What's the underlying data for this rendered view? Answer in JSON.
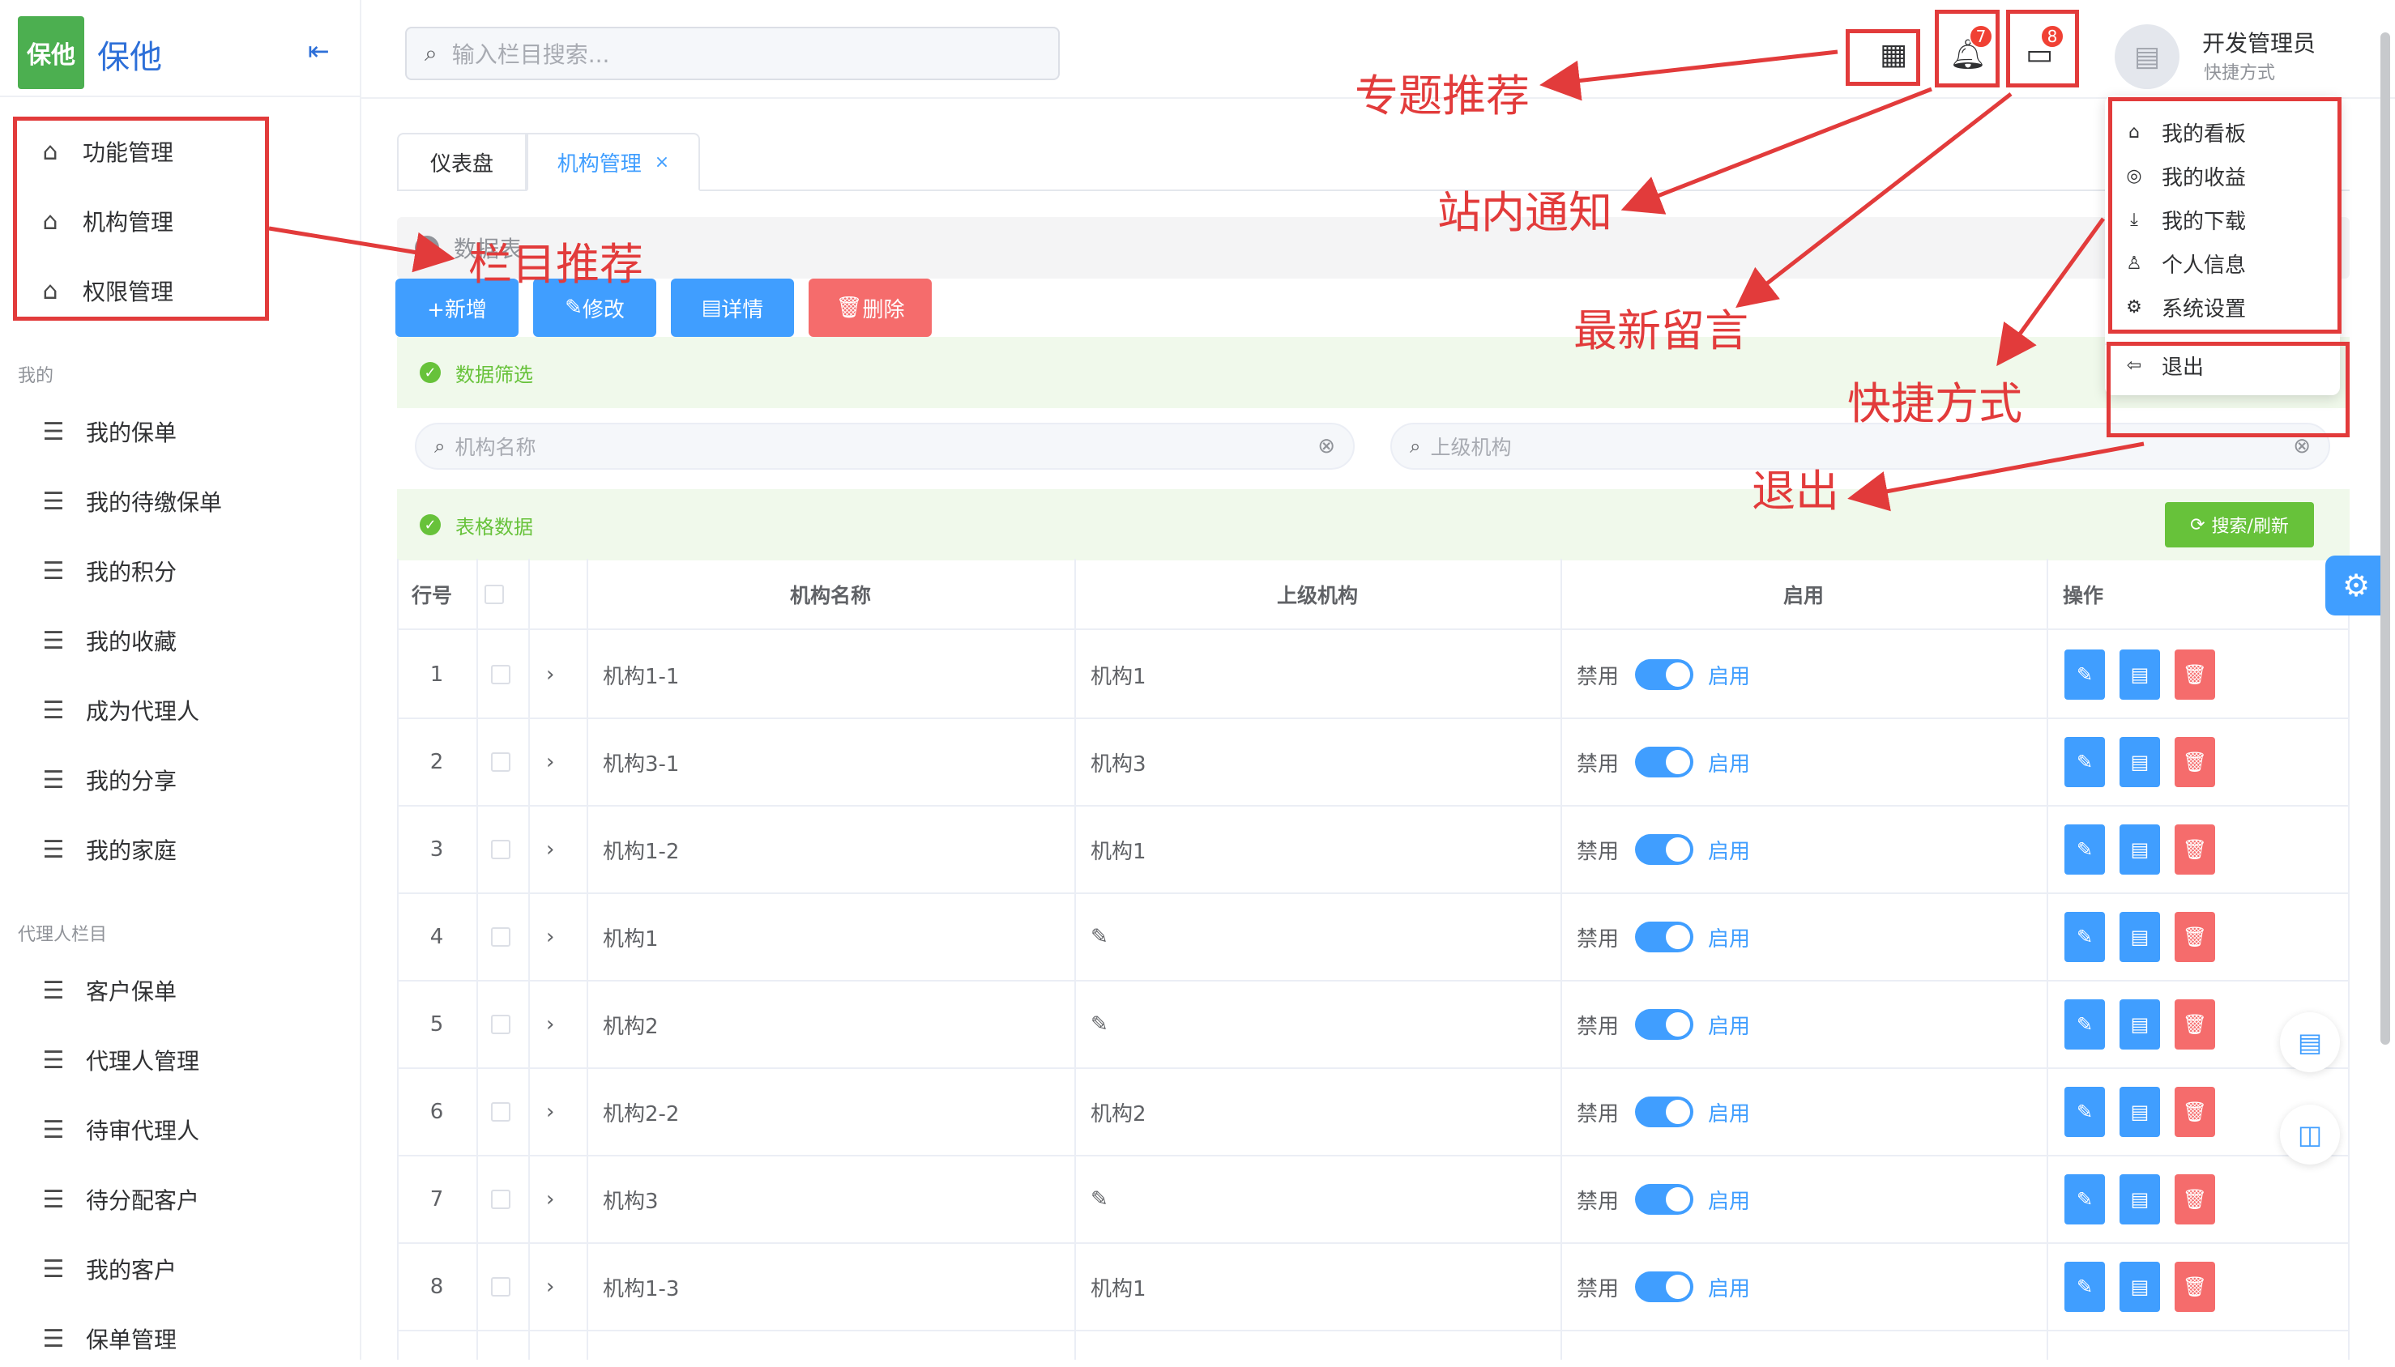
{
  "sidebar": {
    "brand": "保他",
    "logo_text": "保他",
    "top_items": [
      {
        "label": "功能管理",
        "icon": "home-icon"
      },
      {
        "label": "机构管理",
        "icon": "home-icon"
      },
      {
        "label": "权限管理",
        "icon": "home-icon"
      }
    ],
    "groups": [
      {
        "title": "我的",
        "items": [
          "我的保单",
          "我的待缴保单",
          "我的积分",
          "我的收藏",
          "成为代理人",
          "我的分享",
          "我的家庭"
        ]
      },
      {
        "title": "代理人栏目",
        "items": [
          "客户保单",
          "代理人管理",
          "待审代理人",
          "待分配客户",
          "我的客户",
          "保单管理"
        ]
      }
    ]
  },
  "header": {
    "search_placeholder": "输入栏目搜索...",
    "notification_count": "7",
    "message_count": "8",
    "user_name": "开发管理员",
    "user_sub": "快捷方式"
  },
  "dropdown": {
    "items": [
      {
        "label": "我的看板",
        "icon": "home-icon"
      },
      {
        "label": "我的收益",
        "icon": "coin-icon"
      },
      {
        "label": "我的下载",
        "icon": "download-icon"
      },
      {
        "label": "个人信息",
        "icon": "user-icon"
      },
      {
        "label": "系统设置",
        "icon": "gear-icon"
      }
    ],
    "logout": "退出"
  },
  "tabs": [
    {
      "label": "仪表盘",
      "active": false
    },
    {
      "label": "机构管理",
      "active": true
    }
  ],
  "notice_text": "数据表",
  "actions": {
    "add": "+新增",
    "edit": "修改",
    "detail": "详情",
    "delete": "删除"
  },
  "filter": {
    "title": "数据筛选",
    "name_placeholder": "机构名称",
    "parent_placeholder": "上级机构"
  },
  "table_section": {
    "title": "表格数据",
    "search_button": "搜索/刷新"
  },
  "table": {
    "headers": {
      "row": "行号",
      "name": "机构名称",
      "parent": "上级机构",
      "enabled": "启用",
      "ops": "操作"
    },
    "switch_off": "禁用",
    "switch_on": "启用",
    "rows": [
      {
        "no": "1",
        "name": "机构1-1",
        "parent": "机构1"
      },
      {
        "no": "2",
        "name": "机构3-1",
        "parent": "机构3"
      },
      {
        "no": "3",
        "name": "机构1-2",
        "parent": "机构1"
      },
      {
        "no": "4",
        "name": "机构1",
        "parent": ""
      },
      {
        "no": "5",
        "name": "机构2",
        "parent": ""
      },
      {
        "no": "6",
        "name": "机构2-2",
        "parent": "机构2"
      },
      {
        "no": "7",
        "name": "机构3",
        "parent": ""
      },
      {
        "no": "8",
        "name": "机构1-3",
        "parent": "机构1"
      }
    ]
  },
  "annotations": {
    "topic": "专题推荐",
    "column": "栏目推荐",
    "notice": "站内通知",
    "message": "最新留言",
    "shortcut": "快捷方式",
    "logout": "退出"
  },
  "colors": {
    "primary": "#409eff",
    "danger": "#f56c6c",
    "success": "#67c23a",
    "annotation": "#e23b3b",
    "brand": "#4caf50"
  }
}
